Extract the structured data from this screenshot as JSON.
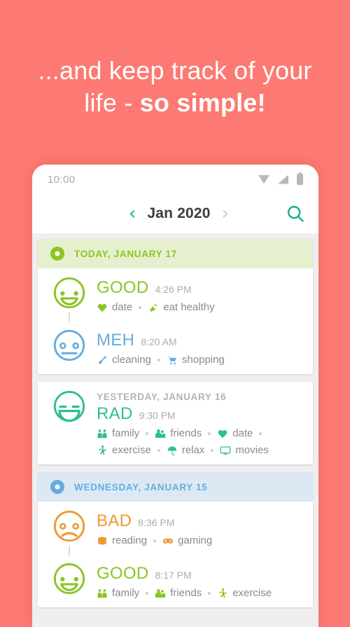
{
  "headline": {
    "line1": "...and keep track of your",
    "line2_plain": "life - ",
    "line2_bold": "so simple!"
  },
  "colors": {
    "background": "#FC7A73",
    "rad": "#2EC08B",
    "good": "#8BC425",
    "meh": "#64ACDE",
    "bad": "#EE9A33",
    "accent_teal": "#18B08A",
    "page_grey": "#EFEFEF"
  },
  "statusbar": {
    "time": "10:00",
    "icons": [
      "wifi-icon",
      "signal-icon",
      "battery-icon"
    ]
  },
  "appbar": {
    "prev_label": "‹",
    "month": "Jan 2020",
    "next_label": "›",
    "search_icon": "search-icon"
  },
  "feed": {
    "sections": [
      {
        "day_label": "TODAY, JANUARY 17",
        "color": "#8BC425",
        "header_bg": "#E6F0CE",
        "header_dot": "day-dot-icon",
        "entries": [
          {
            "sub_date": "",
            "mood": "GOOD",
            "mood_class": "c-good",
            "face": "face-good",
            "time": "4:26 PM",
            "tags": [
              {
                "icon": "heart-icon",
                "label": "date"
              },
              {
                "icon": "carrot-icon",
                "label": "eat healthy"
              }
            ]
          },
          {
            "sub_date": "",
            "mood": "MEH",
            "mood_class": "c-meh",
            "face": "face-meh",
            "time": "8:20 AM",
            "tags": [
              {
                "icon": "broom-icon",
                "label": "cleaning"
              },
              {
                "icon": "cart-icon",
                "label": "shopping"
              }
            ]
          }
        ]
      },
      {
        "day_label": "",
        "color": "#2EC08B",
        "header_bg": "",
        "header_dot": "",
        "entries": [
          {
            "sub_date": "YESTERDAY, JANUARY 16",
            "mood": "RAD",
            "mood_class": "c-rad",
            "face": "face-rad",
            "time": "9:30 PM",
            "tags": [
              {
                "icon": "family-icon",
                "label": "family"
              },
              {
                "icon": "friends-icon",
                "label": "friends"
              },
              {
                "icon": "heart-icon",
                "label": "date"
              },
              {
                "icon": "exercise-icon",
                "label": "exercise"
              },
              {
                "icon": "umbrella-icon",
                "label": "relax"
              },
              {
                "icon": "monitor-icon",
                "label": "movies"
              }
            ]
          }
        ]
      },
      {
        "day_label": "WEDNESDAY, JANUARY 15",
        "color": "#64ACDE",
        "header_bg": "#DCE9F4",
        "header_dot": "day-dot-icon",
        "entries": [
          {
            "sub_date": "",
            "mood": "BAD",
            "mood_class": "c-bad",
            "face": "face-bad",
            "time": "8:36 PM",
            "tags": [
              {
                "icon": "book-icon",
                "label": "reading"
              },
              {
                "icon": "gamepad-icon",
                "label": "gaming"
              }
            ]
          },
          {
            "sub_date": "",
            "mood": "GOOD",
            "mood_class": "c-good",
            "face": "face-good",
            "time": "8:17 PM",
            "tags": [
              {
                "icon": "family-icon",
                "label": "family"
              },
              {
                "icon": "friends-icon",
                "label": "friends"
              },
              {
                "icon": "exercise-icon",
                "label": "exercise"
              }
            ]
          }
        ]
      }
    ]
  }
}
